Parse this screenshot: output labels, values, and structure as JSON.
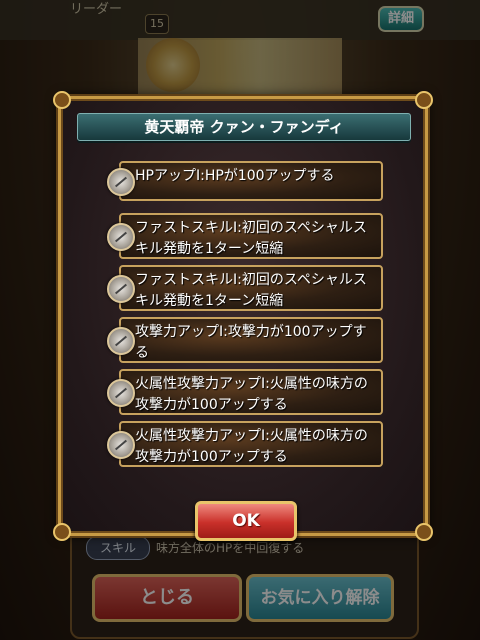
{
  "background": {
    "leader_label": "リーダー",
    "level": "15",
    "detail_button": "詳細",
    "skill_pill": "スキル",
    "skill_description": "味方全体のHPを中回復する",
    "close_button": "とじる",
    "favorite_button": "お気に入り解除"
  },
  "dialog": {
    "title": "黄天覇帝 クァン・ファンディ",
    "abilities": [
      {
        "icon": "hp-up-icon",
        "text": "HPアップⅠ:HPが100アップする"
      },
      {
        "icon": "fast-skill-icon",
        "text": "ファストスキルⅠ:初回のスペシャルスキル発動を1ターン短縮"
      },
      {
        "icon": "fast-skill-icon",
        "text": "ファストスキルⅠ:初回のスペシャルスキル発動を1ターン短縮"
      },
      {
        "icon": "attack-up-icon",
        "text": "攻撃力アップⅠ:攻撃力が100アップする"
      },
      {
        "icon": "fire-attack-up-icon",
        "text": "火属性攻撃力アップⅠ:火属性の味方の攻撃力が100アップする"
      },
      {
        "icon": "fire-attack-up-icon",
        "text": "火属性攻撃力アップⅠ:火属性の味方の攻撃力が100アップする"
      }
    ],
    "ok_button": "OK"
  },
  "colors": {
    "frame_gold": "#c79a45",
    "title_teal": "#2b5a5e",
    "ok_red": "#c9302a"
  }
}
